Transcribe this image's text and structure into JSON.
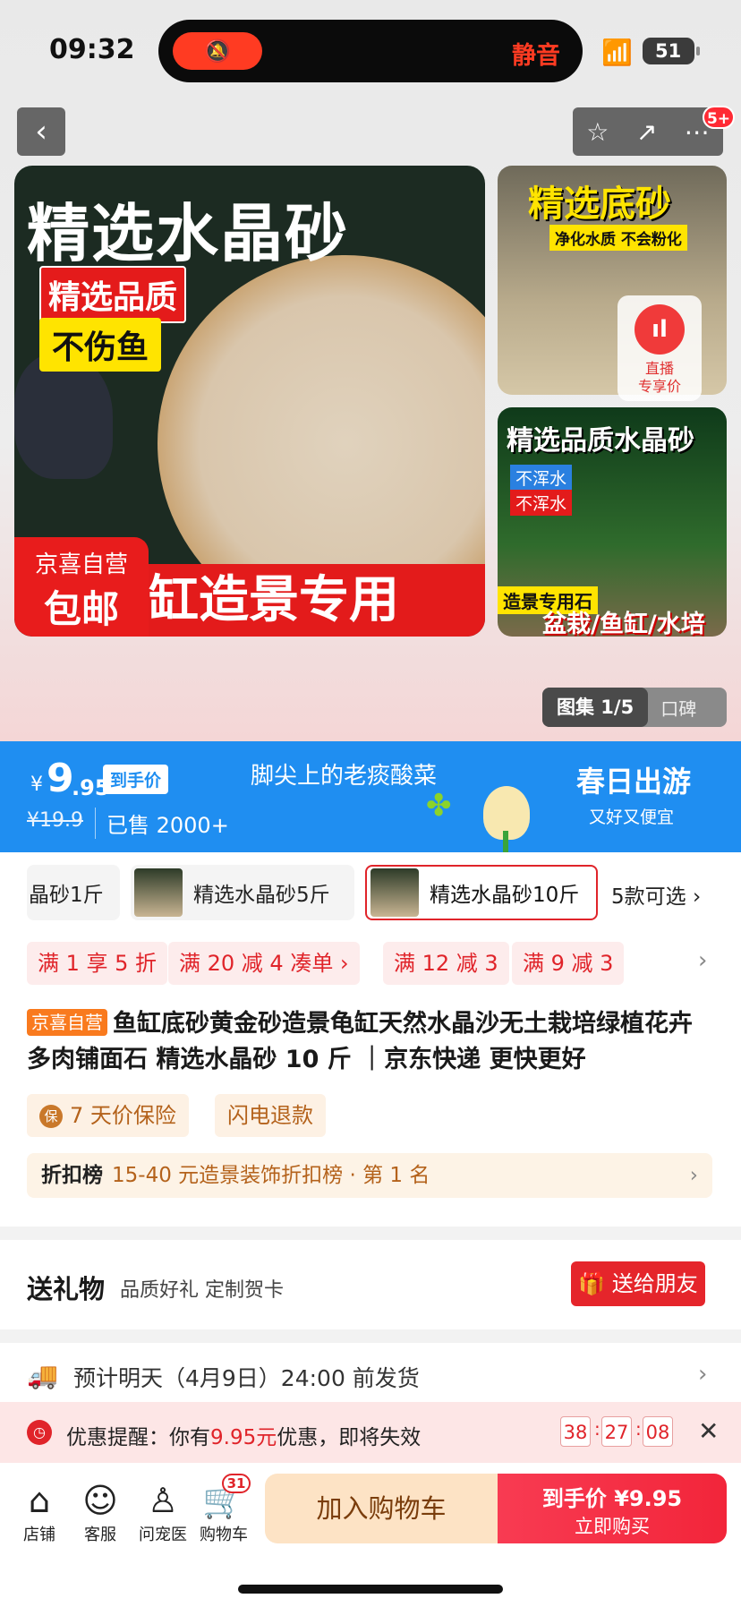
{
  "status_bar": {
    "time": "09:32",
    "mute_label": "静音",
    "battery": "51"
  },
  "nav": {
    "share_badge": "5+"
  },
  "gallery": {
    "main_title": "精选水晶砂",
    "main_tag1": "精选品质",
    "main_tag2": "不伤鱼",
    "main_jx_top": "京喜自营",
    "main_jx_bottom": "包邮",
    "main_band": "缸造景专用",
    "thumb1_title": "精选底砂",
    "thumb1_sub": "净化水质 不会粉化",
    "live_line1": "直播",
    "live_line2": "专享价",
    "thumb2_title": "精选品质水晶砂",
    "thumb2_tag1": "不浑水",
    "thumb2_tag2": "不浑水",
    "thumb2_tag3": "造景专用石",
    "thumb2_bottom": "盆栽/鱼缸/水培",
    "tab_gallery": "图集 1/5",
    "tab_reviews": "口碑"
  },
  "price_banner": {
    "currency": "¥",
    "price_int": "9",
    "price_dec": ".95",
    "price_label": "到手价",
    "original_price": "¥19.9",
    "sold": "已售 2000+",
    "slogan": "脚尖上的老痰酸菜",
    "campaign": "春日出游",
    "campaign_sub": "又好又便宜"
  },
  "specs": {
    "items": [
      "晶砂1斤",
      "精选水晶砂5斤",
      "精选水晶砂10斤"
    ],
    "more": "5款可选 ›"
  },
  "promos": [
    "满 1 享 5 折",
    "满 20 减 4  凑单 ›",
    "满 12 减 3",
    "满 9 减 3"
  ],
  "product": {
    "store_tag": "京喜自营",
    "title": "鱼缸底砂黄金砂造景龟缸天然水晶沙无土栽培绿植花卉多肉铺面石 精选水晶砂 10 斤 ｜京东快递 更快更好"
  },
  "services": {
    "insurance_badge": "保",
    "insurance": "7 天价保险",
    "refund": "闪电退款"
  },
  "rank": {
    "label": "折扣榜",
    "text": "15-40 元造景装饰折扣榜 · 第 1 名"
  },
  "gift": {
    "heading": "送礼物",
    "sub": "品质好礼 定制贺卡",
    "button": "🎁 送给朋友"
  },
  "shipping": {
    "text": "预计明天（4月9日）24:00 前发货"
  },
  "reminder": {
    "prefix": "优惠提醒：你有",
    "amount": "9.95元",
    "suffix": "优惠，即将失效",
    "hours": "38",
    "minutes": "27",
    "seconds": "08"
  },
  "bottom_bar": {
    "store": "店铺",
    "service": "客服",
    "vet": "问宠医",
    "cart": "购物车",
    "cart_count": "31",
    "add_cart": "加入购物车",
    "buy_price": "到手价 ¥9.95",
    "buy_label": "立即购买"
  }
}
